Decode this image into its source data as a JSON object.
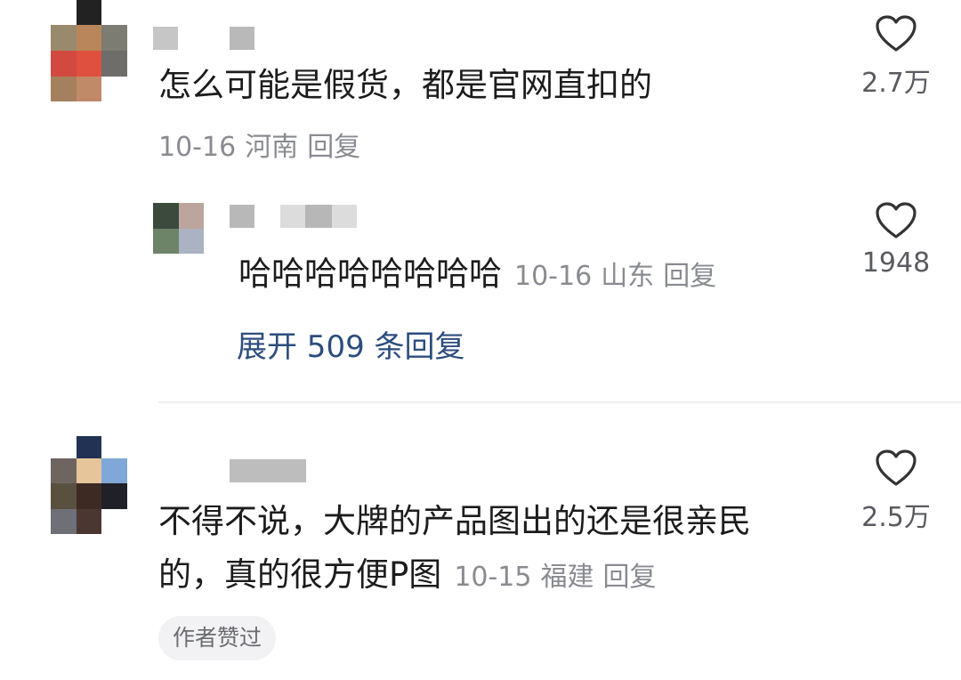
{
  "comments": [
    {
      "text": "怎么可能是假货，都是官网直扣的",
      "date": "10-16",
      "location": "河南",
      "reply_label": "回复",
      "likes": "2.7万",
      "replies": [
        {
          "text": "哈哈哈哈哈哈哈哈",
          "date": "10-16",
          "location": "山东",
          "reply_label": "回复",
          "likes": "1948"
        }
      ],
      "expand_label": "展开 509 条回复"
    },
    {
      "text_line1": "不得不说，大牌的产品图出的还是很亲民",
      "text_line2": "的，真的很方便P图",
      "date": "10-15",
      "location": "福建",
      "reply_label": "回复",
      "likes": "2.5万",
      "badge": "作者赞过"
    }
  ],
  "icons": {
    "like": "heart-outline-icon"
  },
  "colors": {
    "link": "#2c4d7d",
    "meta": "#8a8b91",
    "text": "#1c1c1c"
  }
}
